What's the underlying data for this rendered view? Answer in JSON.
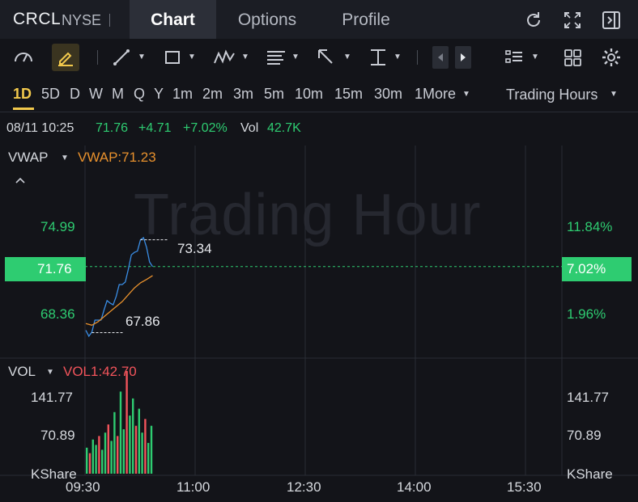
{
  "header": {
    "ticker": "CRCL",
    "exchange": "NYSE",
    "tabs": [
      {
        "label": "Chart",
        "active": true
      },
      {
        "label": "Options",
        "active": false
      },
      {
        "label": "Profile",
        "active": false
      }
    ],
    "icons": [
      "refresh-icon",
      "fullscreen-icon",
      "sidebar-toggle-icon"
    ]
  },
  "toolbar": {
    "icons": [
      "speedometer-icon",
      "draw-pen-icon",
      "line-tool-icon",
      "rectangle-tool-icon",
      "pattern-tool-icon",
      "fibonacci-tool-icon",
      "arrow-tool-icon",
      "measure-tool-icon",
      "prev-arrow-icon",
      "next-arrow-icon",
      "indicator-list-icon",
      "layout-grid-icon",
      "settings-gear-icon"
    ]
  },
  "intervals": {
    "items": [
      "1D",
      "5D",
      "D",
      "W",
      "M",
      "Q",
      "Y",
      "1m",
      "2m",
      "3m",
      "5m",
      "10m",
      "15m",
      "30m",
      "1More"
    ],
    "selected": "1D",
    "session": "Trading Hours"
  },
  "quote": {
    "datetime": "08/11 10:25",
    "price": "71.76",
    "change": "+4.71",
    "change_pct": "+7.02%",
    "vol_label": "Vol",
    "vol_value": "42.7K"
  },
  "main_panel": {
    "indicator": "VWAP",
    "indicator_value": "VWAP:71.23",
    "watermark": "Trading Hour",
    "y_left": [
      "74.99",
      "71.76",
      "68.36"
    ],
    "y_right": [
      "11.84%",
      "7.02%",
      "1.96%"
    ],
    "high_label": "73.34",
    "low_label": "67.86"
  },
  "volume_panel": {
    "indicator": "VOL",
    "indicator_value": "VOL1:42.70",
    "y_left": [
      "141.77",
      "70.89",
      "KShare"
    ],
    "y_right": [
      "141.77",
      "70.89",
      "KShare"
    ]
  },
  "x_axis": [
    "09:30",
    "11:00",
    "12:30",
    "14:00",
    "15:30"
  ],
  "colors": {
    "up": "#2ecc71",
    "down": "#f2545b",
    "price_line": "#3a8ee6",
    "vwap_line": "#e8912d",
    "accent": "#f2c94c",
    "price_tag": "#2ecc71"
  },
  "chart_data": {
    "type": "line",
    "x": [
      "09:30",
      "09:35",
      "09:40",
      "09:45",
      "09:50",
      "09:55",
      "10:00",
      "10:05",
      "10:10",
      "10:15",
      "10:20",
      "10:25"
    ],
    "series": [
      {
        "name": "price",
        "values": [
          68.0,
          67.9,
          68.6,
          69.2,
          69.6,
          70.0,
          70.7,
          71.6,
          72.6,
          73.34,
          72.9,
          71.76
        ]
      },
      {
        "name": "VWAP",
        "values": [
          68.4,
          68.3,
          68.5,
          68.8,
          69.1,
          69.4,
          69.7,
          70.1,
          70.5,
          70.8,
          71.0,
          71.23
        ]
      }
    ],
    "ylim": [
      66.5,
      77.0
    ],
    "volume": [
      38,
      30,
      50,
      42,
      55,
      35,
      60,
      72,
      48,
      90,
      55,
      120,
      65,
      150,
      85,
      110,
      70,
      95,
      60,
      80,
      45,
      70
    ],
    "volume_ylim": [
      0,
      141.77
    ],
    "high": 73.34,
    "low": 67.86,
    "last": 71.76
  }
}
